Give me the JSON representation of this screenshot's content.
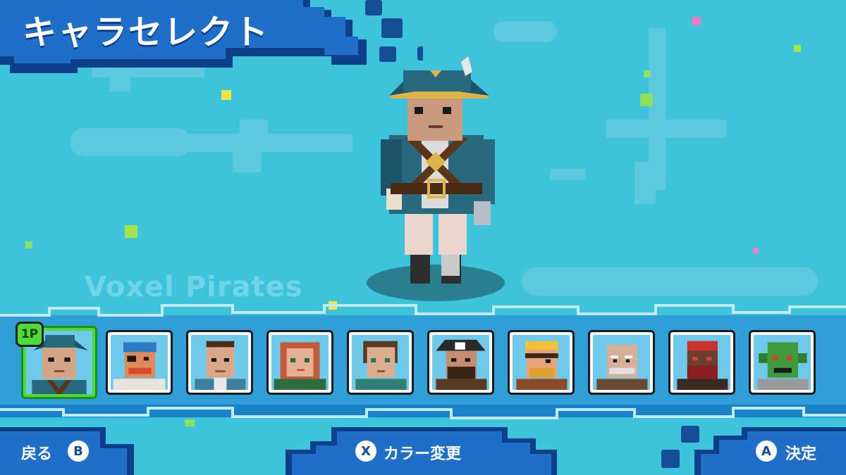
{
  "header": {
    "title": "キャラセレクト"
  },
  "background": {
    "watermark": "Voxel Pirates"
  },
  "colors": {
    "sky": "#3ec3dc",
    "banner_blue": "#1f6fc8",
    "banner_dark": "#0d3f8a",
    "selected_green": "#4ddc37"
  },
  "roster": {
    "player_badge": "1P",
    "selected_index": 0,
    "characters": [
      {
        "id": "captain",
        "icon": "captain-portrait-icon"
      },
      {
        "id": "bandana-eyepatch",
        "icon": "bandana-pirate-portrait-icon"
      },
      {
        "id": "sailor",
        "icon": "sailor-portrait-icon"
      },
      {
        "id": "redhead",
        "icon": "redhead-portrait-icon"
      },
      {
        "id": "brunette",
        "icon": "brunette-portrait-icon"
      },
      {
        "id": "bearded-captain",
        "icon": "skull-hat-pirate-portrait-icon"
      },
      {
        "id": "blond",
        "icon": "blond-pirate-portrait-icon"
      },
      {
        "id": "old-sailor",
        "icon": "old-sailor-portrait-icon"
      },
      {
        "id": "red-skull",
        "icon": "red-pirate-portrait-icon"
      },
      {
        "id": "fishman",
        "icon": "fishman-portrait-icon"
      }
    ]
  },
  "footer": {
    "back": {
      "label": "戻る",
      "button": "B"
    },
    "color": {
      "label": "カラー変更",
      "button": "X"
    },
    "confirm": {
      "label": "決定",
      "button": "A"
    }
  }
}
